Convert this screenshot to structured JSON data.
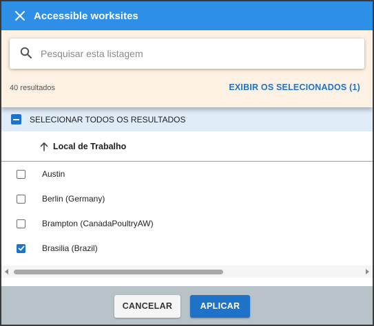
{
  "dialog": {
    "title": "Accessible worksites"
  },
  "search": {
    "placeholder": "Pesquisar esta listagem",
    "value": ""
  },
  "results": {
    "count_text": "40 resultados",
    "show_selected_label": "EXIBIR OS SELECIONADOS (1)"
  },
  "select_all": {
    "label": "SELECIONAR TODOS OS RESULTADOS",
    "state": "indeterminate"
  },
  "table": {
    "column_header": "Local de Trabalho",
    "sort_direction": "ascending",
    "rows": [
      {
        "label": "Austin",
        "checked": false
      },
      {
        "label": "Berlin (Germany)",
        "checked": false
      },
      {
        "label": "Brampton (CanadaPoultryAW)",
        "checked": false
      },
      {
        "label": "Brasilia (Brazil)",
        "checked": true
      }
    ]
  },
  "footer": {
    "cancel_label": "CANCELAR",
    "apply_label": "APLICAR"
  },
  "colors": {
    "header_bg": "#2d8fe6",
    "accent": "#1e73c8",
    "search_panel_bg": "#fdf1e3",
    "select_all_bg": "#e0ecf8",
    "footer_bg": "#b8c2c9"
  },
  "icons": {
    "close": "close-icon",
    "search": "search-icon",
    "sort": "arrow-up-icon",
    "check": "checkmark-icon"
  }
}
